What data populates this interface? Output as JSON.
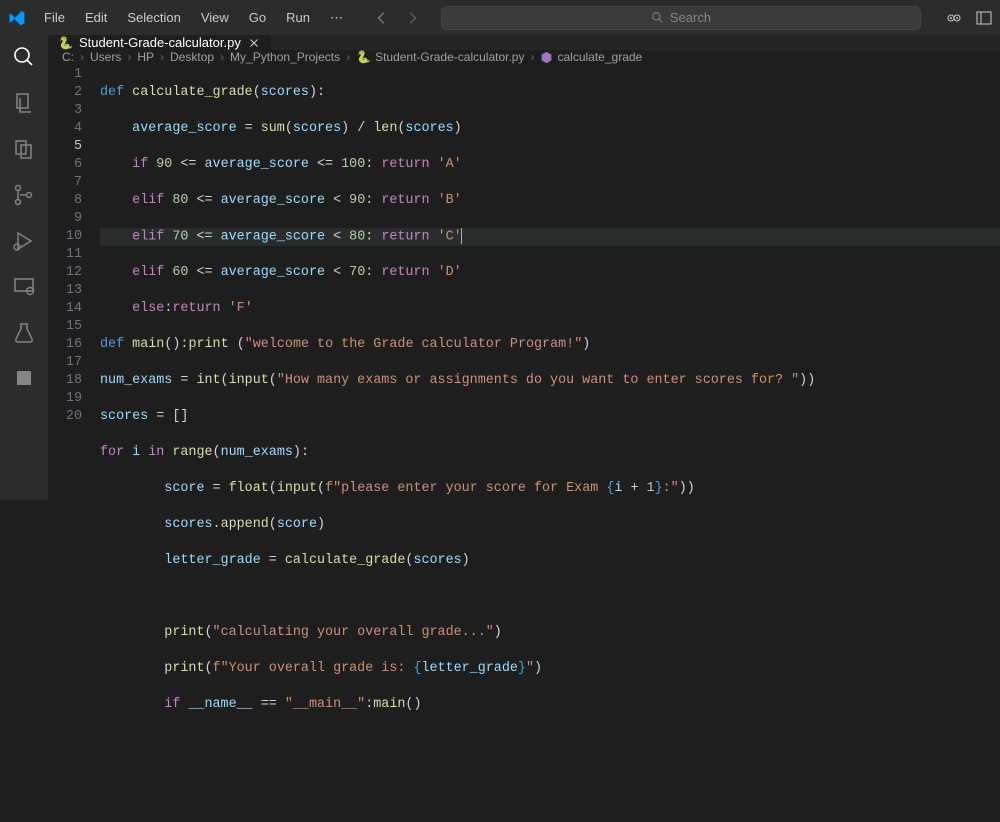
{
  "menu": {
    "file": "File",
    "edit": "Edit",
    "selection": "Selection",
    "view": "View",
    "go": "Go",
    "run": "Run",
    "dots": "⋯"
  },
  "search": {
    "placeholder": "Search"
  },
  "tab": {
    "name": "Student-Grade-calculator.py"
  },
  "breadcrumb": {
    "c": "C:",
    "users": "Users",
    "hp": "HP",
    "desktop": "Desktop",
    "proj": "My_Python_Projects",
    "file": "Student-Grade-calculator.py",
    "fn": "calculate_grade"
  },
  "ln": {
    "l1": "1",
    "l2": "2",
    "l3": "3",
    "l4": "4",
    "l5": "5",
    "l6": "6",
    "l7": "7",
    "l8": "8",
    "l9": "9",
    "l10": "10",
    "l11": "11",
    "l12": "12",
    "l13": "13",
    "l14": "14",
    "l15": "15",
    "l16": "16",
    "l17": "17",
    "l18": "18",
    "l19": "19",
    "l20": "20"
  },
  "c": {
    "def": "def ",
    "elif": "elif ",
    "if": "if ",
    "else": "else",
    "return": "return ",
    "for": "for ",
    "in": "in ",
    "eq": " = ",
    "le": " <= ",
    "lt": " < ",
    "col": ": ",
    "colon": ":",
    "lp": "(",
    "rp": ")",
    "lb": "[",
    "rb": "]",
    "div": " / ",
    "eqeq": " == ",
    "plus": " + ",
    "comma": ",",
    "calculate_grade": "calculate_grade",
    "main": "main",
    "print": "print",
    "int": "int",
    "input": "input",
    "float": "float",
    "range": "range",
    "sum": "sum",
    "len": "len",
    "append": "append",
    "scores": "scores",
    "average_score": "average_score",
    "num_exams": "num_exams",
    "score": "score",
    "letter_grade": "letter_grade",
    "i": "i",
    "__name__": "__name__",
    "n90": "90",
    "n100": "100",
    "n80": "80",
    "n70": "70",
    "n60": "60",
    "n1": "1",
    "A": "'A'",
    "B": "'B'",
    "C": "'C'",
    "D": "'D'",
    "F": "'F'",
    "s_welcome": "\"welcome to the Grade calculator Program!\"",
    "s_howmany": "\"How many exams or assignments do you want to enter scores for? \"",
    "s_please1": "f\"please enter your score for Exam ",
    "s_please2": ":\"",
    "s_calc": "\"calculating your overall grade...\"",
    "s_overall1": "f\"Your overall grade is: ",
    "s_overall2": "\"",
    "s_main": "\"__main__\"",
    "lcb": "{",
    "rcb": "}",
    "dot": ".",
    "sp": " "
  }
}
